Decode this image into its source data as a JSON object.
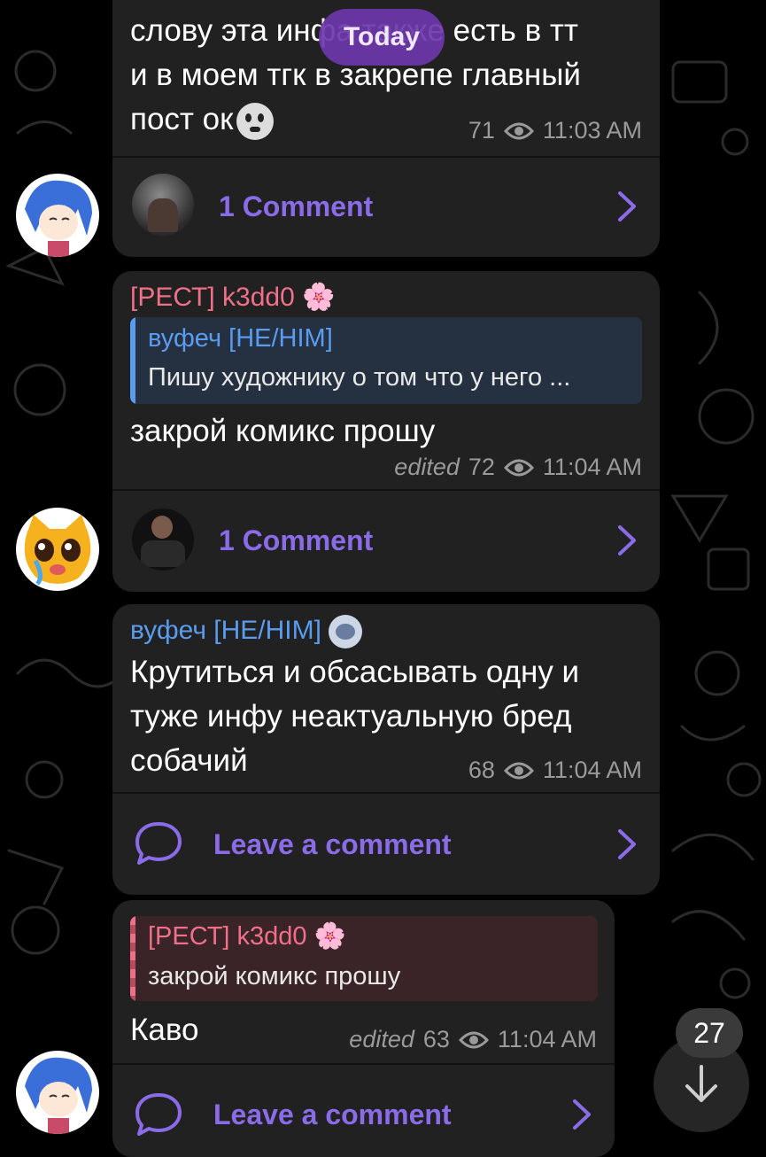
{
  "date_pill": "Today",
  "unread_badge": "27",
  "messages": [
    {
      "text_lines": [
        "слову эта инфа также есть в тт",
        "и в моем тгк в закрепе главный",
        "пост ок"
      ],
      "views": "71",
      "time": "11:03 AM",
      "comment_label": "1 Comment"
    },
    {
      "sender": "[РЕСТ] k3dd0",
      "sender_emoji": "🌸",
      "reply_sender": "вуфеч [HE/HIM]",
      "reply_text": "Пишу художнику о том что у него ...",
      "text": "закрой комикс прошу",
      "edited": "edited",
      "views": "72",
      "time": "11:04 AM",
      "comment_label": "1 Comment"
    },
    {
      "sender": "вуфеч [HE/HIM]",
      "text_lines": [
        "Крутиться и обсасывать одну и",
        "туже инфу неактуальную бред",
        "собачий"
      ],
      "views": "68",
      "time": "11:04 AM",
      "comment_label": "Leave a comment"
    },
    {
      "reply_sender": "[РЕСТ] k3dd0",
      "reply_sender_emoji": "🌸",
      "reply_text": "закрой комикс прошу",
      "text": "Каво",
      "edited": "edited",
      "views": "63",
      "time": "11:04 AM",
      "comment_label": "Leave a comment"
    }
  ],
  "colors": {
    "accent": "#8a6ce8",
    "bubble": "#212121",
    "pink_sender": "#f0708a",
    "blue_sender": "#5a9cf0"
  }
}
